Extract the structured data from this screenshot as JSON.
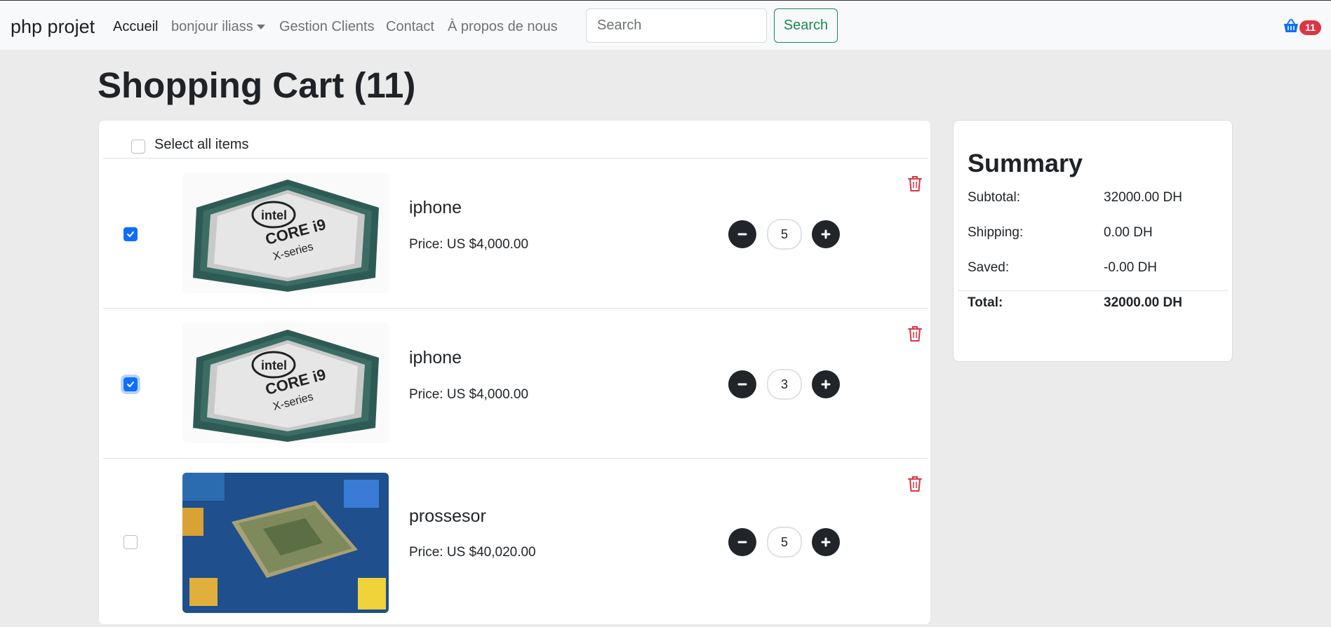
{
  "navbar": {
    "brand": "php projet",
    "links": [
      "Accueil",
      "bonjour iliass",
      "Gestion Clients",
      "Contact",
      "À propos de nous"
    ],
    "search_placeholder": "Search",
    "search_button": "Search",
    "cart_count": "11",
    "cart_icon": "basket-icon"
  },
  "page": {
    "title": "Shopping Cart (11)"
  },
  "cart": {
    "select_all_label": "Select all items",
    "items": [
      {
        "name": "iphone",
        "price": "Price: US $4,000.00",
        "quantity": "5",
        "checked": true,
        "image": "intel-core-i9-cpu"
      },
      {
        "name": "iphone",
        "price": "Price: US $4,000.00",
        "quantity": "3",
        "checked": true,
        "image": "intel-core-i9-cpu"
      },
      {
        "name": "prossesor",
        "price": "Price: US $40,020.00",
        "quantity": "5",
        "checked": false,
        "image": "processor-chip-photo"
      }
    ]
  },
  "summary": {
    "title": "Summary",
    "subtotal_label": "Subtotal:",
    "subtotal_value": "32000.00 DH",
    "shipping_label": "Shipping:",
    "shipping_value": "0.00 DH",
    "saved_label": "Saved:",
    "saved_value": "-0.00 DH",
    "total_label": "Total:",
    "total_value": "32000.00 DH"
  },
  "colors": {
    "primary": "#0d6efd",
    "success": "#198754",
    "danger": "#dc3545",
    "dark": "#212529",
    "page_background": "#ebebeb"
  }
}
